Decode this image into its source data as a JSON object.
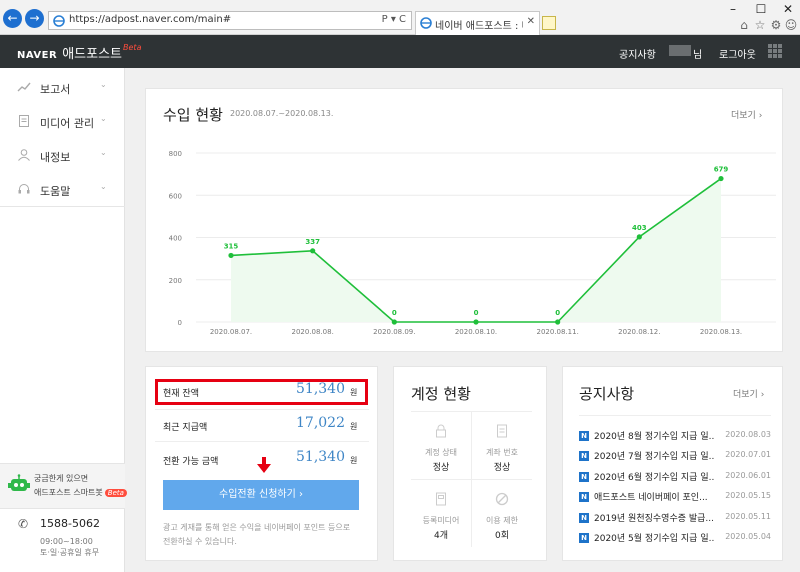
{
  "browser": {
    "url": "https://adpost.naver.com/main#",
    "tab_title": "네이버 애드포스트 : 미디...",
    "address_controls": "P ▾ C"
  },
  "topbar": {
    "logo_naver": "NAVER",
    "logo_service": "애드포스트",
    "logo_beta": "Beta",
    "notice_link": "공지사항",
    "user_suffix": "님",
    "logout": "로그아웃"
  },
  "sidebar": {
    "items": [
      {
        "label": "보고서",
        "icon": "chart-line-icon"
      },
      {
        "label": "미디어 관리",
        "icon": "document-icon"
      },
      {
        "label": "내정보",
        "icon": "person-icon"
      },
      {
        "label": "도움말",
        "icon": "headset-icon"
      }
    ],
    "help_line1": "궁금한게 있으면",
    "help_line2": "애드포스트 스마트봇",
    "help_badge": "Beta",
    "phone": "1588-5062",
    "hours_line1": "09:00~18:00",
    "hours_line2": "토·일·공휴일 휴무"
  },
  "income": {
    "title": "수입 현황",
    "period": "2020.08.07.~2020.08.13.",
    "more": "더보기 ›"
  },
  "chart_data": {
    "type": "area",
    "x": [
      "2020.08.07.",
      "2020.08.08.",
      "2020.08.09.",
      "2020.08.10.",
      "2020.08.11.",
      "2020.08.12.",
      "2020.08.13."
    ],
    "series": [
      {
        "values": [
          315,
          337,
          0,
          0,
          0,
          403,
          679
        ]
      }
    ],
    "ylim": [
      0,
      800
    ],
    "yticks": [
      0,
      200,
      400,
      600,
      800
    ],
    "grid": true,
    "line_color": "#1fbf3a",
    "fill_color": "#eefaef"
  },
  "earnings": {
    "rows": [
      {
        "label": "현재 잔액",
        "value": "51,340",
        "unit": "원"
      },
      {
        "label": "최근 지급액",
        "value": "17,022",
        "unit": "원"
      },
      {
        "label": "전환 가능 금액",
        "value": "51,340",
        "unit": "원"
      }
    ],
    "convert_button": "수입전환 신청하기 ›",
    "note_line1": "광고 게재를 통해 얻은 수익을 네이버페이 포인트 등으로",
    "note_line2": "전환하실 수 있습니다."
  },
  "account": {
    "title": "계정 현황",
    "cells": [
      {
        "label": "계정 상태",
        "value": "정상",
        "icon": "lock-icon"
      },
      {
        "label": "계좌 번호",
        "value": "정상",
        "icon": "doc-icon"
      },
      {
        "label": "등록미디어",
        "value": "4개",
        "icon": "page-icon"
      },
      {
        "label": "이용 제한",
        "value": "0회",
        "icon": "prohibited-icon"
      }
    ]
  },
  "notices": {
    "title": "공지사항",
    "more": "더보기 ›",
    "items": [
      {
        "title": "2020년 8월 정기수입 지급 일...",
        "date": "2020.08.03"
      },
      {
        "title": "2020년 7월 정기수입 지급 일...",
        "date": "2020.07.01"
      },
      {
        "title": "2020년 6월 정기수입 지급 일...",
        "date": "2020.06.01"
      },
      {
        "title": "애드포스트 네이버페이 포인...",
        "date": "2020.05.15"
      },
      {
        "title": "2019년 원천징수영수증 발급...",
        "date": "2020.05.11"
      },
      {
        "title": "2020년 5월 정기수입 지급 일...",
        "date": "2020.05.04"
      }
    ]
  },
  "colors": {
    "accent_blue": "#61a8ec",
    "value_blue": "#3f86c6",
    "highlight_red": "#e60012",
    "topbar": "#2e3335"
  }
}
